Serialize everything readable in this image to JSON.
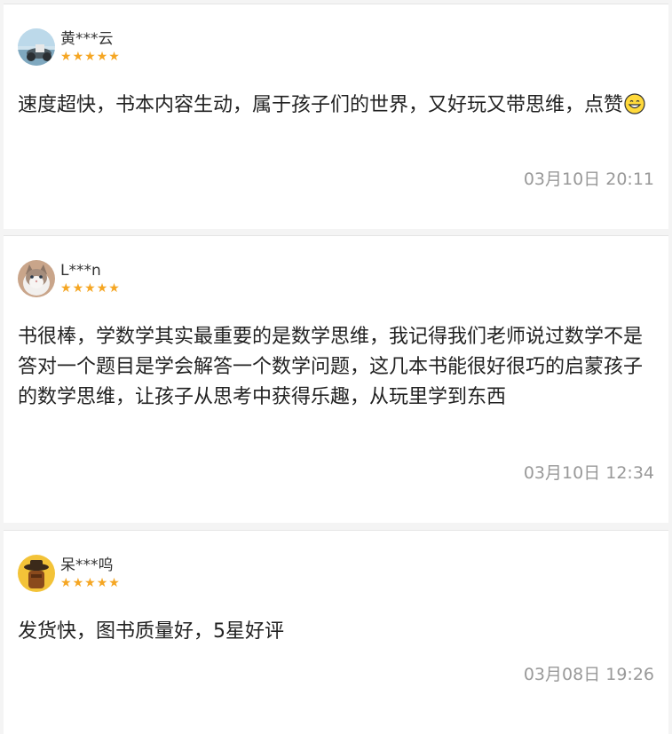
{
  "reviews": [
    {
      "user": "黄***云",
      "rating": 5,
      "star_glyph": "★",
      "text": "速度超快，书本内容生动，属于孩子们的世界，又好玩又带思维，点赞",
      "emoji_icon": "grinning-face-emoji",
      "date": "03月10日 20:11"
    },
    {
      "user": "L***n",
      "rating": 5,
      "star_glyph": "★",
      "text": "书很棒，学数学其实最重要的是数学思维，我记得我们老师说过数学不是答对一个题目是学会解答一个数学问题，这几本书能很好很巧的启蒙孩子的数学思维，让孩子从思考中获得乐趣，从玩里学到东西",
      "date": "03月10日 12:34"
    },
    {
      "user": "呆***呜",
      "rating": 5,
      "star_glyph": "★",
      "text": "发货快，图书质量好，5星好评",
      "date": "03月08日 19:26"
    }
  ],
  "colors": {
    "star": "#f5a623",
    "date": "#999999",
    "text": "#222222",
    "background": "#f4f4f4"
  }
}
